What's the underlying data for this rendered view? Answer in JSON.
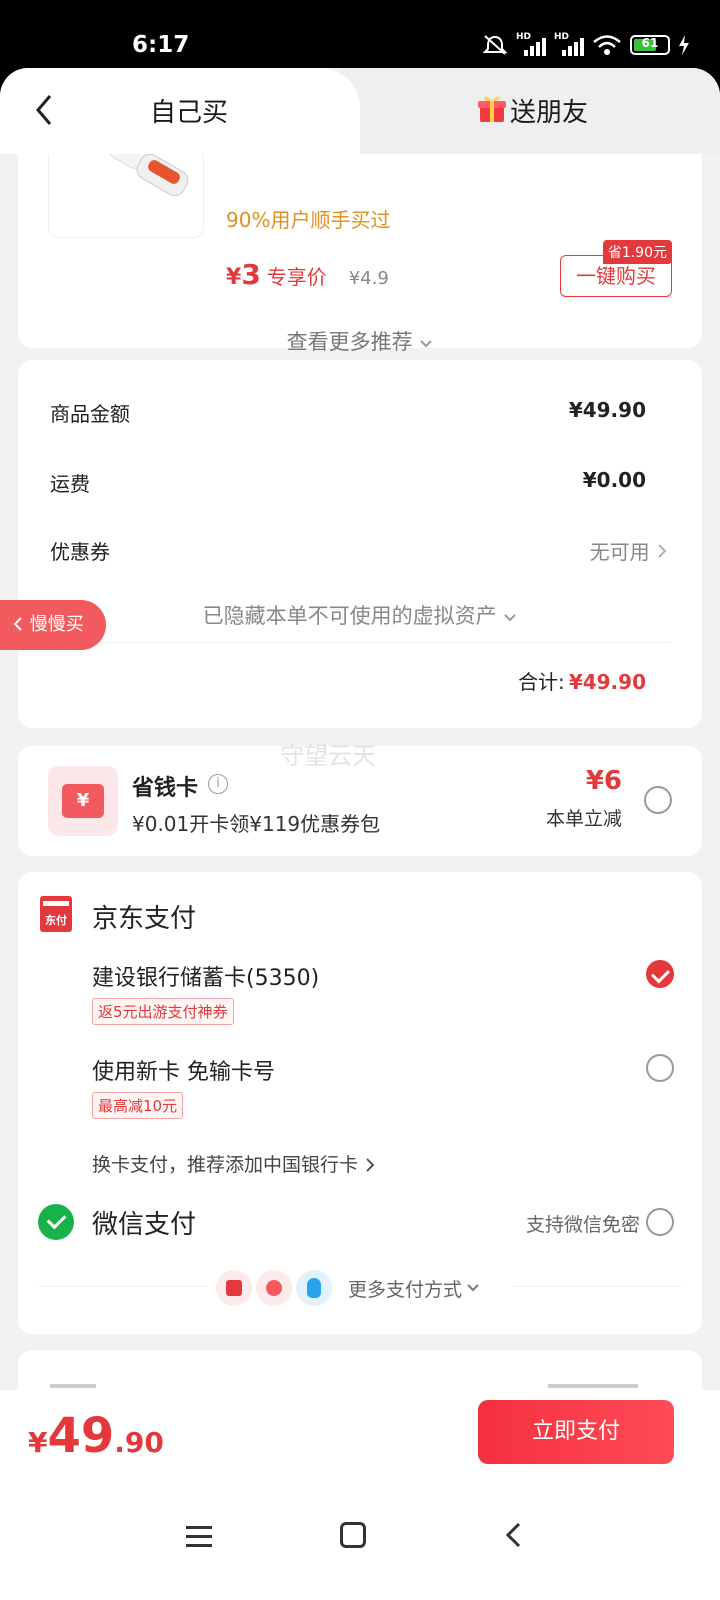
{
  "status_bar": {
    "time": "6:17",
    "battery": "61",
    "network_label": "HD"
  },
  "tabs": {
    "self": "自己买",
    "friend": "送朋友"
  },
  "recommendation": {
    "hint": "90%用户顺手买过",
    "currency": "¥",
    "price": "3",
    "price_label": "专享价",
    "original_price": "¥4.9",
    "buy_button": "一键购买",
    "save_tag": "省1.90元",
    "see_more": "查看更多推荐"
  },
  "summary": {
    "goods_label": "商品金额",
    "goods_value": "¥49.90",
    "shipping_label": "运费",
    "shipping_value": "¥0.00",
    "coupon_label": "优惠券",
    "coupon_value": "无可用",
    "hidden_assets": "已隐藏本单不可使用的虚拟资产",
    "total_label": "合计:",
    "total_value": "¥49.90"
  },
  "floating": {
    "slow_buy": "慢慢买",
    "watermark": "守望云天"
  },
  "saver_card": {
    "icon_symbol": "¥",
    "title": "省钱卡",
    "info_symbol": "i",
    "subtitle": "¥0.01开卡领¥119优惠券包",
    "amount": "¥6",
    "note": "本单立减"
  },
  "payment": {
    "jd_icon_text": "东付",
    "jd_title": "京东支付",
    "option1_label": "建设银行储蓄卡(5350)",
    "option1_tag": "返5元出游支付神券",
    "option2_label": "使用新卡 免输卡号",
    "option2_tag": "最高减10元",
    "switch_card": "换卡支付，推荐添加中国银行卡",
    "wechat_title": "微信支付",
    "wechat_note": "支持微信免密",
    "more_methods": "更多支付方式"
  },
  "bottom_bar": {
    "currency": "¥",
    "amount_int": "49",
    "amount_dec": ".90",
    "pay_button": "立即支付"
  },
  "colors": {
    "accent": "#e4393c",
    "hint_orange": "#e0901c",
    "wechat_green": "#18b24a"
  }
}
